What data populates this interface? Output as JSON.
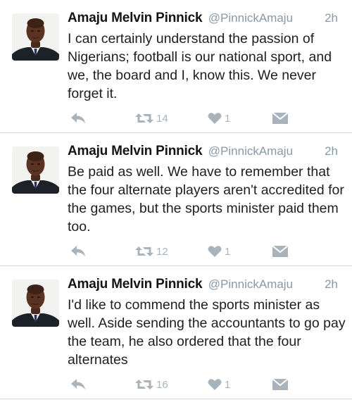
{
  "tweets": [
    {
      "author": "Amaju Melvin Pinnick",
      "handle": "@PinnickAmaju",
      "time": "2h",
      "text": "I can certainly understand the passion of Nigerians; football is our national sport, and we, the board and I, know this. We never forget it.",
      "retweets": "14",
      "likes": "1"
    },
    {
      "author": "Amaju Melvin Pinnick",
      "handle": "@PinnickAmaju",
      "time": "2h",
      "text": "Be paid as well. We have to remember that the four alternate players aren't accredited for the games, but the sports minister paid them too.",
      "retweets": "12",
      "likes": "1"
    },
    {
      "author": "Amaju Melvin Pinnick",
      "handle": "@PinnickAmaju",
      "time": "2h",
      "text": "I'd like to commend the sports minister as well. Aside sending the accountants to go pay the team, he also ordered that the four alternates",
      "retweets": "16",
      "likes": "1"
    }
  ],
  "icons": {
    "reply": "reply-icon",
    "retweet": "retweet-icon",
    "like": "heart-icon",
    "message": "direct-message-icon"
  },
  "colors": {
    "action_icon": "#a9b3bb",
    "secondary_text": "#8899a6",
    "divider": "#d8dce0"
  }
}
